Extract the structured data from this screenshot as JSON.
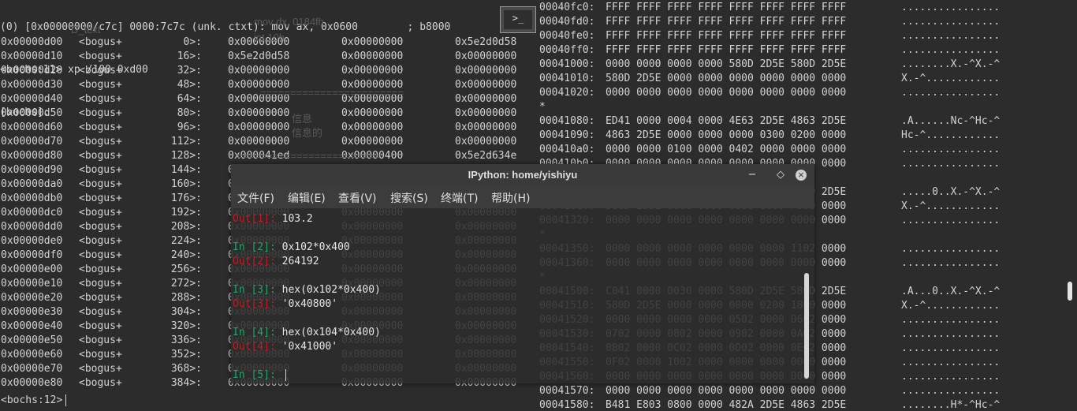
{
  "left_terminal": {
    "top_line": "(0) [0x00000000/c7c] 0000:7c7c (unk. ctxt): mov ax, 0x0600        ; b8000",
    "command_line": "<bochs:11> xp /100 0xd00",
    "bochs_line": "[bochs]:",
    "rows": [
      {
        "addr": "0x00000d00",
        "label": "<bogus+",
        "off": "0>:",
        "v1": "0x00000000",
        "v2": "0x00000000",
        "v3": "0x5e2d0d58"
      },
      {
        "addr": "0x00000d10",
        "label": "<bogus+",
        "off": "16>:",
        "v1": "0x5e2d0d58",
        "v2": "0x00000000",
        "v3": "0x00000000"
      },
      {
        "addr": "0x00000d20",
        "label": "<bogus+",
        "off": "32>:",
        "v1": "0x00000000",
        "v2": "0x00000000",
        "v3": "0x00000000"
      },
      {
        "addr": "0x00000d30",
        "label": "<bogus+",
        "off": "48>:",
        "v1": "0x00000000",
        "v2": "0x00000000",
        "v3": "0x00000000"
      },
      {
        "addr": "0x00000d40",
        "label": "<bogus+",
        "off": "64>:",
        "v1": "0x00000000",
        "v2": "0x00000000",
        "v3": "0x00000000"
      },
      {
        "addr": "0x00000d50",
        "label": "<bogus+",
        "off": "80>:",
        "v1": "0x00000000",
        "v2": "0x00000000",
        "v3": "0x00000000"
      },
      {
        "addr": "0x00000d60",
        "label": "<bogus+",
        "off": "96>:",
        "v1": "0x00000000",
        "v2": "0x00000000",
        "v3": "0x00000000"
      },
      {
        "addr": "0x00000d70",
        "label": "<bogus+",
        "off": "112>:",
        "v1": "0x00000000",
        "v2": "0x00000000",
        "v3": "0x00000000"
      },
      {
        "addr": "0x00000d80",
        "label": "<bogus+",
        "off": "128>:",
        "v1": "0x000041ed",
        "v2": "0x00000400",
        "v3": "0x5e2d634e"
      },
      {
        "addr": "0x00000d90",
        "label": "<bogus+",
        "off": "144>:",
        "v1": "0x00000000",
        "v2": "0x00000000",
        "v3": "0x00000000"
      },
      {
        "addr": "0x00000da0",
        "label": "<bogus+",
        "off": "160>:",
        "v1": "0x00000000",
        "v2": "0x00000000",
        "v3": "0x00000000"
      },
      {
        "addr": "0x00000db0",
        "label": "<bogus+",
        "off": "176>:",
        "v1": "0x00000000",
        "v2": "0x00000000",
        "v3": "0x00000000"
      },
      {
        "addr": "0x00000dc0",
        "label": "<bogus+",
        "off": "192>:",
        "v1": "0x00000000",
        "v2": "0x00000000",
        "v3": "0x00000000"
      },
      {
        "addr": "0x00000dd0",
        "label": "<bogus+",
        "off": "208>:",
        "v1": "0x00000000",
        "v2": "0x00000000",
        "v3": "0x00000000"
      },
      {
        "addr": "0x00000de0",
        "label": "<bogus+",
        "off": "224>:",
        "v1": "0x00000000",
        "v2": "0x00000000",
        "v3": "0x00000000"
      },
      {
        "addr": "0x00000df0",
        "label": "<bogus+",
        "off": "240>:",
        "v1": "0x00000000",
        "v2": "0x00000000",
        "v3": "0x00000000"
      },
      {
        "addr": "0x00000e00",
        "label": "<bogus+",
        "off": "256>:",
        "v1": "0x00000000",
        "v2": "0x00000000",
        "v3": "0x00000000"
      },
      {
        "addr": "0x00000e10",
        "label": "<bogus+",
        "off": "272>:",
        "v1": "0x00000000",
        "v2": "0x00000000",
        "v3": "0x00000000"
      },
      {
        "addr": "0x00000e20",
        "label": "<bogus+",
        "off": "288>:",
        "v1": "0x00000000",
        "v2": "0x00000000",
        "v3": "0x00000000"
      },
      {
        "addr": "0x00000e30",
        "label": "<bogus+",
        "off": "304>:",
        "v1": "0x00000000",
        "v2": "0x00000000",
        "v3": "0x00000000"
      },
      {
        "addr": "0x00000e40",
        "label": "<bogus+",
        "off": "320>:",
        "v1": "0x00000000",
        "v2": "0x00000000",
        "v3": "0x00000000"
      },
      {
        "addr": "0x00000e50",
        "label": "<bogus+",
        "off": "336>:",
        "v1": "0x00000000",
        "v2": "0x00000000",
        "v3": "0x00000000"
      },
      {
        "addr": "0x00000e60",
        "label": "<bogus+",
        "off": "352>:",
        "v1": "0x00000000",
        "v2": "0x00000000",
        "v3": "0x00000000"
      },
      {
        "addr": "0x00000e70",
        "label": "<bogus+",
        "off": "368>:",
        "v1": "0x00000000",
        "v2": "0x00000000",
        "v3": "0x00000000"
      },
      {
        "addr": "0x00000e80",
        "label": "<bogus+",
        "off": "384>:",
        "v1": "0x00000000",
        "v2": "0x00000000",
        "v3": "0x00000000"
      }
    ],
    "prompt": "<bochs:12>",
    "ghost_lines": [
      "D_text",
      "mov dx, 0184fh",
      "int 10h",
      "========================",
      "信息",
      "信息的",
      "========================",
      "0x00000000"
    ]
  },
  "right_terminal": {
    "rows": [
      {
        "addr": "00040fc0:",
        "hex": "FFFF FFFF FFFF FFFF FFFF FFFF FFFF FFFF",
        "ascii": "................"
      },
      {
        "addr": "00040fd0:",
        "hex": "FFFF FFFF FFFF FFFF FFFF FFFF FFFF FFFF",
        "ascii": "................"
      },
      {
        "addr": "00040fe0:",
        "hex": "FFFF FFFF FFFF FFFF FFFF FFFF FFFF FFFF",
        "ascii": "................"
      },
      {
        "addr": "00040ff0:",
        "hex": "FFFF FFFF FFFF FFFF FFFF FFFF FFFF FFFF",
        "ascii": "................"
      },
      {
        "addr": "00041000:",
        "hex": "0000 0000 0000 0000 580D 2D5E 580D 2D5E",
        "ascii": "........X.-^X.-^"
      },
      {
        "addr": "00041010:",
        "hex": "580D 2D5E 0000 0000 0000 0000 0000 0000",
        "ascii": "X.-^............"
      },
      {
        "addr": "00041020:",
        "hex": "0000 0000 0000 0000 0000 0000 0000 0000",
        "ascii": "................"
      },
      {
        "addr": "*",
        "hex": "",
        "ascii": ""
      },
      {
        "addr": "00041080:",
        "hex": "ED41 0000 0004 0000 4E63 2D5E 4863 2D5E",
        "ascii": ".A......Nc-^Hc-^"
      },
      {
        "addr": "00041090:",
        "hex": "4863 2D5E 0000 0000 0000 0300 0200 0000",
        "ascii": "Hc-^............"
      },
      {
        "addr": "000410a0:",
        "hex": "0000 0000 0100 0000 0402 0000 0000 0000",
        "ascii": "................"
      },
      {
        "addr": "000410b0:",
        "hex": "0000 0000 0000 0000 0000 0000 0000 0000",
        "ascii": "................"
      },
      {
        "addr": "",
        "hex": "",
        "ascii": ""
      },
      {
        "addr": "000410d0:",
        "hex": "0000 0000 0000 0000 580D 2D5E 580D 2D5E",
        "ascii": ".....0..X.-^X.-^"
      },
      {
        "addr": "000410e0:",
        "hex": "580D 2D5E 0000 0000 0000 0000 F809 0000",
        "ascii": "X.-^............"
      },
      {
        "addr": "00041320:",
        "hex": "0000 0000 0000 0000 0000 0000 0000 0000",
        "ascii": "................"
      },
      {
        "addr": "*",
        "hex": "",
        "ascii": ""
      },
      {
        "addr": "00041350:",
        "hex": "0000 0000 0000 0000 0000 0000 1102 0000",
        "ascii": "................"
      },
      {
        "addr": "00041360:",
        "hex": "0000 0000 0000 0000 0000 0000 0000 0000",
        "ascii": "................"
      },
      {
        "addr": "*",
        "hex": "",
        "ascii": ""
      },
      {
        "addr": "00041500:",
        "hex": "C041 0000 0030 0000 580D 2D5E 580D 2D5E",
        "ascii": ".A...0..X.-^X.-^"
      },
      {
        "addr": "00041510:",
        "hex": "580D 2D5E 0000 0000 0000 0200 1800 0000",
        "ascii": "X.-^............"
      },
      {
        "addr": "00041520:",
        "hex": "0000 0000 0000 0000 0502 0000 0602 0000",
        "ascii": "................"
      },
      {
        "addr": "00041530:",
        "hex": "0702 0000 0802 0000 0902 0000 0A02 0000",
        "ascii": "................"
      },
      {
        "addr": "00041540:",
        "hex": "0B02 0000 0C02 0000 0D02 0000 0E02 0000",
        "ascii": "................"
      },
      {
        "addr": "00041550:",
        "hex": "0F02 0000 1002 0000 0000 0000 0000 0000",
        "ascii": "................"
      },
      {
        "addr": "00041560:",
        "hex": "0000 0000 0000 0000 0000 0000 0000 0000",
        "ascii": "................"
      },
      {
        "addr": "00041570:",
        "hex": "0000 0000 0000 0000 0000 0000 0000 0000",
        "ascii": "................"
      },
      {
        "addr": "00041580:",
        "hex": "B481 E803 0800 0000 482A 2D5E 4863 2D5E",
        "ascii": "........H*-^Hc-^"
      }
    ]
  },
  "ipython": {
    "title": "IPython: home/yishiyu",
    "menu": [
      "文件(F)",
      "编辑(E)",
      "查看(V)",
      "搜索(S)",
      "终端(T)",
      "帮助(H)"
    ],
    "icon_text": ">_",
    "lines": [
      {
        "kind": "out",
        "prompt": "Out[1]:",
        "text": "103.2"
      },
      {
        "kind": "in",
        "prompt": "In [2]:",
        "text": "0x102*0x400"
      },
      {
        "kind": "out",
        "prompt": "Out[2]:",
        "text": "264192"
      },
      {
        "kind": "in",
        "prompt": "In [3]:",
        "text": "hex(0x102*0x400)"
      },
      {
        "kind": "out",
        "prompt": "Out[3]:",
        "text": "'0x40800'"
      },
      {
        "kind": "in",
        "prompt": "In [4]:",
        "text": "hex(0x104*0x400)"
      },
      {
        "kind": "out",
        "prompt": "Out[4]:",
        "text": "'0x41000'"
      },
      {
        "kind": "in",
        "prompt": "In [5]:",
        "text": ""
      }
    ]
  },
  "colors": {
    "background": "#2c2c2c",
    "text": "#d3d3d3",
    "out_prompt": "#c01c28",
    "in_prompt": "#26a269"
  }
}
